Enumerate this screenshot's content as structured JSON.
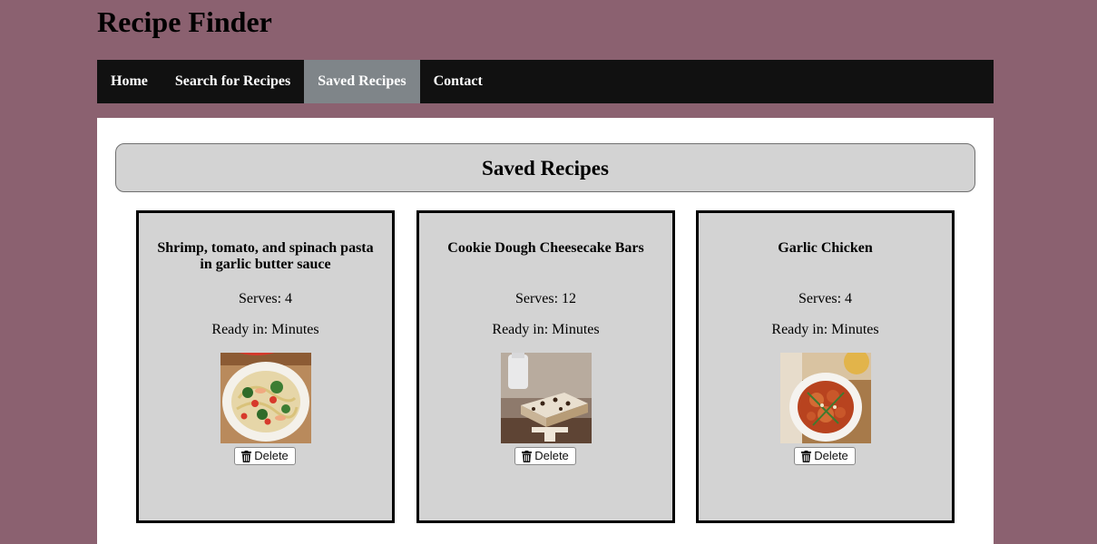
{
  "site": {
    "title": "Recipe Finder"
  },
  "nav": {
    "items": [
      {
        "label": "Home",
        "active": false
      },
      {
        "label": "Search for Recipes",
        "active": false
      },
      {
        "label": "Saved Recipes",
        "active": true
      },
      {
        "label": "Contact",
        "active": false
      }
    ]
  },
  "colors": {
    "page_background": "#8b6170",
    "nav_background": "#111111",
    "nav_active": "#7f8589",
    "card_background": "#d3d3d3"
  },
  "main": {
    "heading": "Saved Recipes",
    "recipes": [
      {
        "title": "Shrimp, tomato, and spinach pasta in garlic butter sauce",
        "serves": "Serves: 4",
        "ready": "Ready in: Minutes",
        "image_icon": "pasta-photo",
        "delete_label": "Delete"
      },
      {
        "title": "Cookie Dough Cheesecake Bars",
        "serves": "Serves: 12",
        "ready": "Ready in: Minutes",
        "image_icon": "cheesecake-photo",
        "delete_label": "Delete"
      },
      {
        "title": "Garlic Chicken",
        "serves": "Serves: 4",
        "ready": "Ready in: Minutes",
        "image_icon": "chicken-stew-photo",
        "delete_label": "Delete"
      }
    ]
  }
}
